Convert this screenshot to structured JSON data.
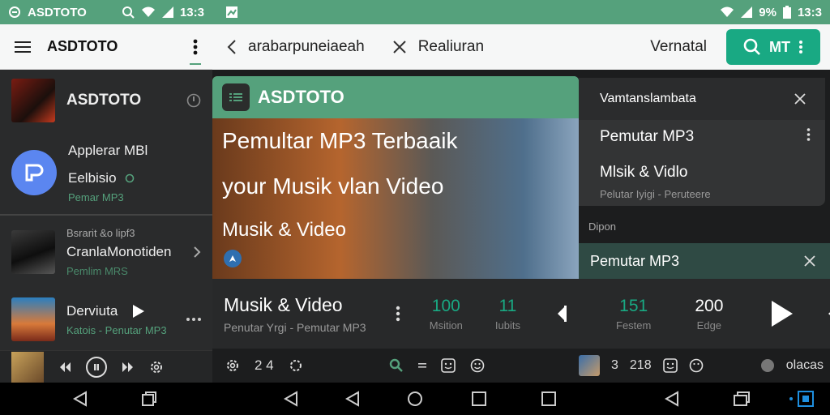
{
  "status_left": {
    "app": "ASDTOTO",
    "time": "13:3"
  },
  "status_right": {
    "battery": "9%",
    "time": "13:3"
  },
  "left_appbar": {
    "title": "ASDTOTO"
  },
  "left_list": [
    {
      "title": "ASDTOTO"
    },
    {
      "title": "Applerar MBl",
      "subtitle": "Eelbisio",
      "caption": "Pemar MP3"
    },
    {
      "title": "Bsrarit &o lipf3",
      "subtitle": "CranlaMonotiden",
      "caption": "Pemlim MRS"
    },
    {
      "title": "Derviuta",
      "caption": "Katois - Penutar MP3"
    }
  ],
  "search_bar": {
    "query": "arabarpuneiaeah",
    "secondary": "Realiuran",
    "right_label": "Vernatal",
    "button_label": "MT"
  },
  "hero": {
    "header": "ASDTOTO",
    "line1": "Pemultar MP3 Terbaaik",
    "line2": "your Musik vlan Video",
    "line3": "Musik & Video"
  },
  "now_playing": {
    "title": "Musik & Video",
    "subtitle": "Penutar Yrgi - Pemutar MP3",
    "stat1_value": "100",
    "stat1_label": "Msition",
    "stat2_value": "11",
    "stat2_label": "Iubits"
  },
  "bottom_mid": {
    "count": "2 4"
  },
  "menu": {
    "header": "Vamtanslambata",
    "item1": "Pemutar MP3",
    "item2": "Mlsik & Vidlo",
    "item2_sub": "Pelutar Iyigi - Peruteere"
  },
  "right_section_label": "Dipon",
  "right_bar": {
    "label": "Pemutar MP3"
  },
  "right_stats": {
    "stat1_value": "151",
    "stat1_label": "Festem",
    "stat2_value": "200",
    "stat2_label": "Edge"
  },
  "bottom_right": {
    "a": "3",
    "b": "218",
    "c": "olacas"
  },
  "colors": {
    "accent": "#55a17c",
    "button": "#19a983",
    "dark": "#202122"
  }
}
